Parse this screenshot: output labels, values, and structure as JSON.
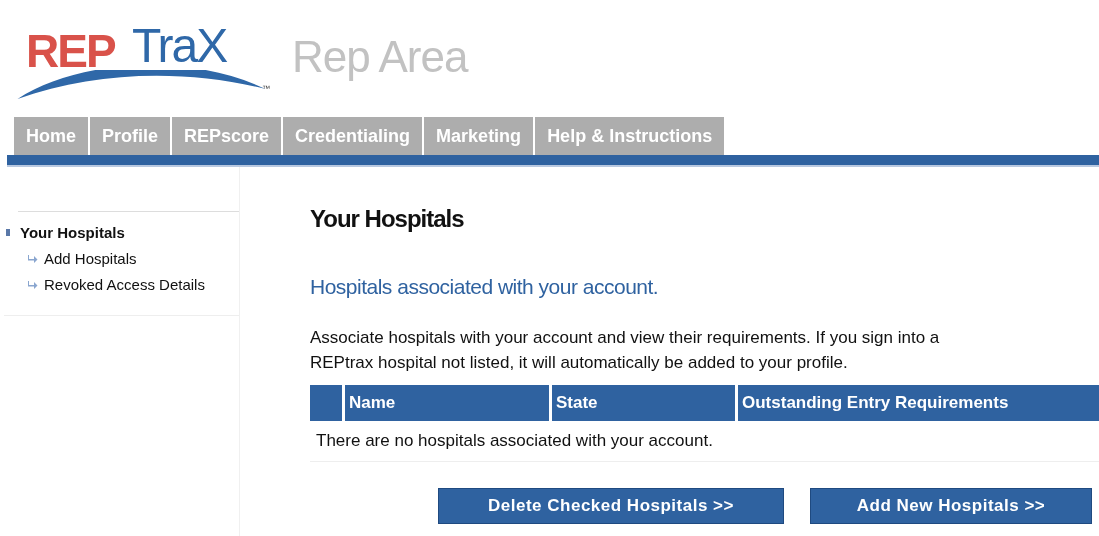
{
  "logo": {
    "part_1": "REP",
    "part_2": "TraX",
    "trademark": "™"
  },
  "area_title": "Rep Area",
  "tabs": [
    {
      "label": "Home"
    },
    {
      "label": "Profile"
    },
    {
      "label": "REPscore"
    },
    {
      "label": "Credentialing"
    },
    {
      "label": "Marketing"
    },
    {
      "label": "Help & Instructions"
    }
  ],
  "sidebar": {
    "items": [
      {
        "label": "Your Hospitals",
        "children": [
          {
            "label": "Add Hospitals"
          },
          {
            "label": "Revoked Access Details"
          }
        ]
      }
    ]
  },
  "page_title": "Your Hospitals",
  "subtitle": "Hospitals associated with your account.",
  "intro": "Associate hospitals with your account and view their requirements. If you sign into a REPtrax hospital not listed, it will automatically be added to your profile.",
  "table": {
    "columns": [
      "Name",
      "State",
      "Outstanding Entry Requirements"
    ],
    "empty_message": "There are no hospitals associated with your account."
  },
  "buttons": [
    "Delete Checked Hospitals >>",
    "Add New Hospitals >>"
  ]
}
